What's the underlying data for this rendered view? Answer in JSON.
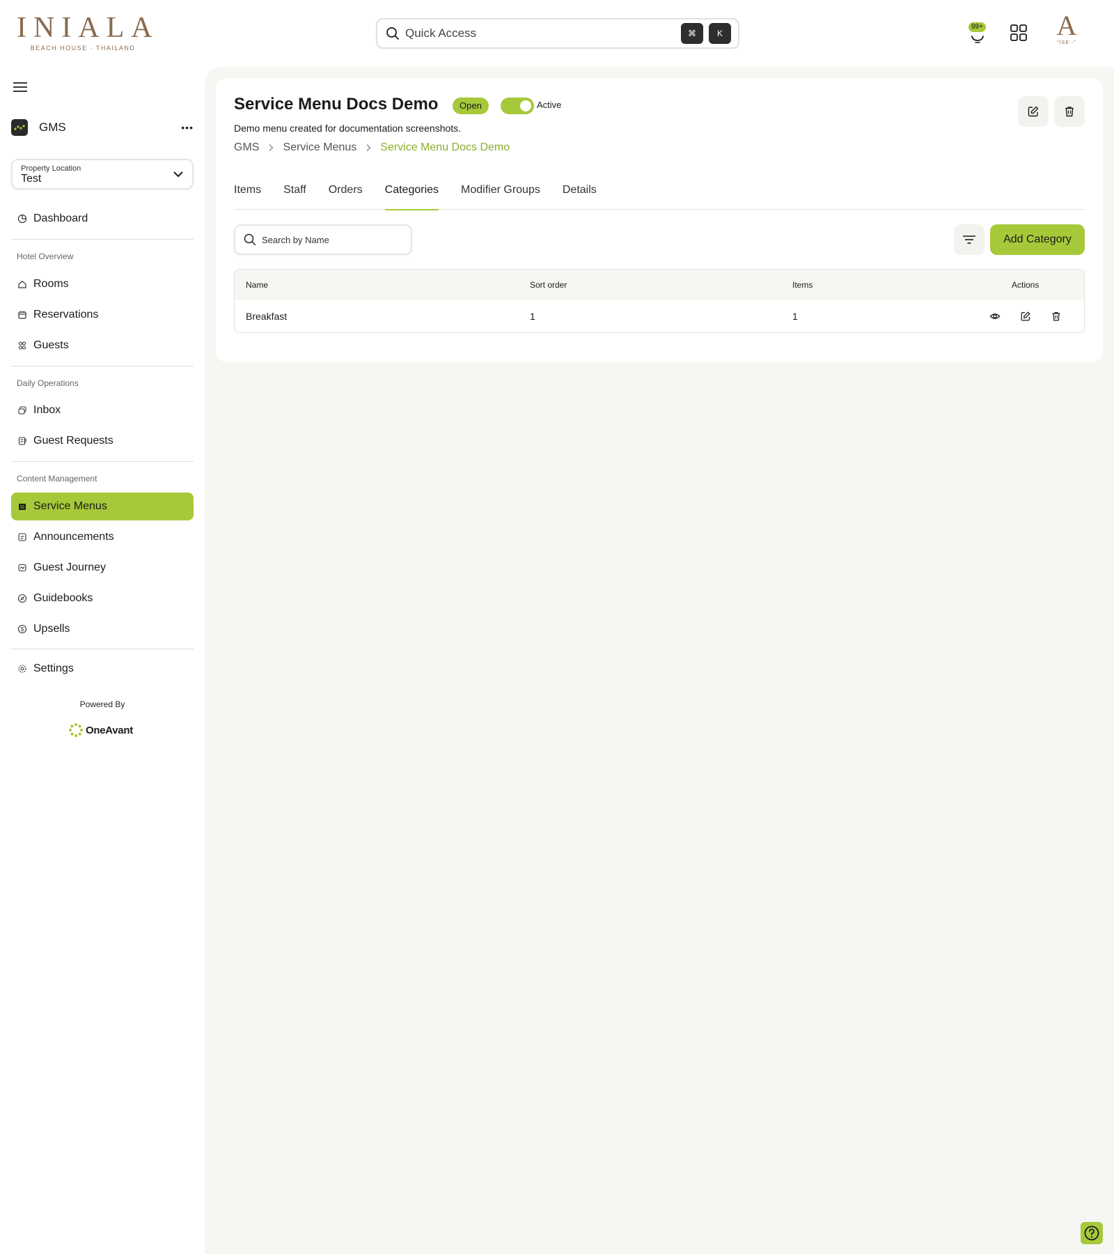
{
  "header": {
    "brand": {
      "name": "INIALA",
      "subtitle": "BEACH HOUSE · THAILAND"
    },
    "quick_access": {
      "label": "Quick Access",
      "shortcut_keys": [
        "⌘",
        "K"
      ]
    },
    "notifications": {
      "badge": "99+",
      "icon": "bell-icon"
    },
    "apps_icon": "grid-icon",
    "account": {
      "logo_letter": "A",
      "logo_sub": "\"ISE -\""
    }
  },
  "sidebar": {
    "app": {
      "label": "GMS",
      "more": "•••"
    },
    "property": {
      "label": "Property Location",
      "value": "Test"
    },
    "dashboard": "Dashboard",
    "sections": [
      {
        "title": "Hotel Overview",
        "items": [
          "Rooms",
          "Reservations",
          "Guests"
        ]
      },
      {
        "title": "Daily Operations",
        "items": [
          "Inbox",
          "Guest Requests"
        ]
      },
      {
        "title": "Content Management",
        "items": [
          "Service Menus",
          "Announcements",
          "Guest Journey",
          "Guidebooks",
          "Upsells"
        ]
      }
    ],
    "settings": "Settings",
    "powered_by": "Powered By",
    "powered_brand": "OneAvant",
    "active_item": "Service Menus"
  },
  "page": {
    "title": "Service Menu Docs Demo",
    "status": "Open",
    "toggle": {
      "label": "Active",
      "on": true
    },
    "description": "Demo menu created for documentation screenshots.",
    "breadcrumb": [
      "GMS",
      "Service Menus",
      "Service Menu Docs Demo"
    ],
    "tabs": [
      "Items",
      "Staff",
      "Orders",
      "Categories",
      "Modifier Groups",
      "Details"
    ],
    "active_tab": "Categories",
    "search": {
      "placeholder": "Search by Name",
      "value": ""
    },
    "add_button": "Add Category",
    "table": {
      "columns": [
        "Name",
        "Sort order",
        "Items",
        "Actions"
      ],
      "rows": [
        {
          "name": "Breakfast",
          "sort_order": "1",
          "items": "1"
        }
      ]
    }
  },
  "colors": {
    "accent": "#a6c93a",
    "brand": "#8a6a4e",
    "breadcrumb_current": "#8fae2c",
    "background": "#f6f6f2"
  }
}
